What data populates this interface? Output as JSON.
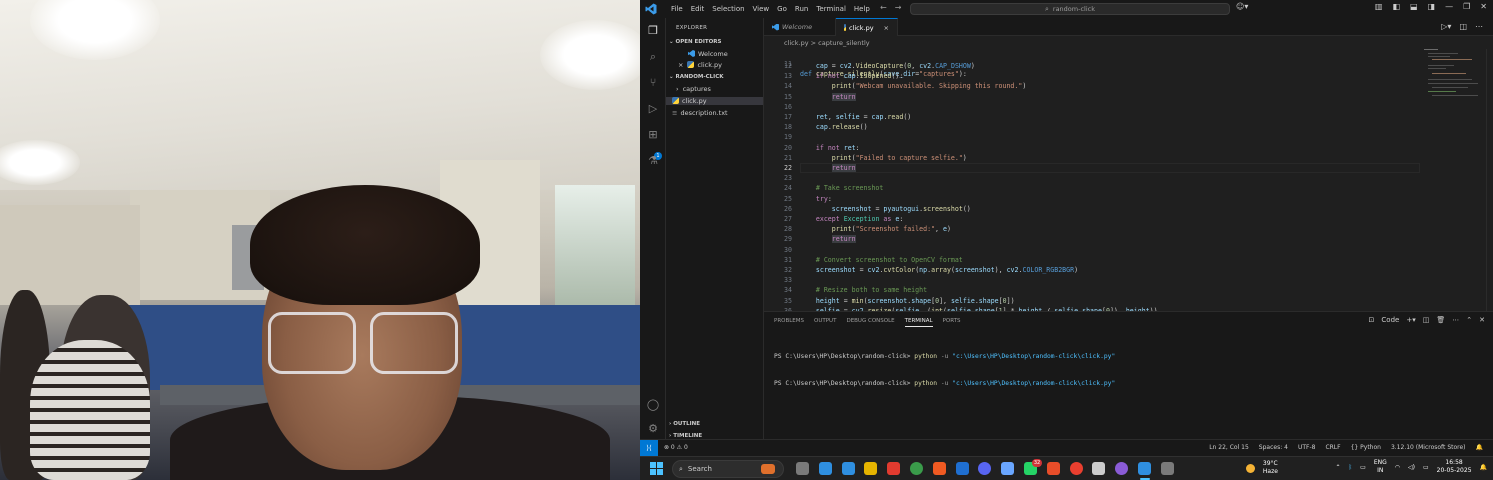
{
  "window": {
    "menu": [
      "File",
      "Edit",
      "Selection",
      "View",
      "Go",
      "Run",
      "Terminal",
      "Help"
    ],
    "command_center": "random-click"
  },
  "sidebar": {
    "title": "EXPLORER",
    "open_editors_label": "OPEN EDITORS",
    "open_editors": [
      {
        "label": "Welcome",
        "icon": "vscode-icon"
      },
      {
        "label": "click.py",
        "icon": "python-file-icon",
        "close": "×"
      }
    ],
    "folder_label": "RANDOM-CLICK",
    "tree": [
      {
        "label": "captures",
        "type": "folder",
        "chevron": "›"
      },
      {
        "label": "click.py",
        "type": "file"
      },
      {
        "label": "description.txt",
        "type": "file"
      }
    ],
    "outline_label": "OUTLINE",
    "timeline_label": "TIMELINE"
  },
  "tabs": [
    {
      "label": "Welcome",
      "active": false
    },
    {
      "label": "click.py",
      "active": true,
      "close": "×"
    }
  ],
  "breadcrumb": {
    "file": "click.py",
    "sep": ">",
    "symbol": "capture_silently"
  },
  "code": {
    "header": "def capture_silently(save_dir=\"captures\"):",
    "current_line": 22,
    "lines": [
      {
        "n": 12,
        "text": "    cap = cv2.VideoCapture(0, cv2.CAP_DSHOW)"
      },
      {
        "n": 13,
        "text": "    if not cap.isOpened():"
      },
      {
        "n": 14,
        "text": "        print(\"Webcam unavailable. Skipping this round.\")"
      },
      {
        "n": 15,
        "text": "        return"
      },
      {
        "n": 16,
        "text": ""
      },
      {
        "n": 17,
        "text": "    ret, selfie = cap.read()"
      },
      {
        "n": 18,
        "text": "    cap.release()"
      },
      {
        "n": 19,
        "text": ""
      },
      {
        "n": 20,
        "text": "    if not ret:"
      },
      {
        "n": 21,
        "text": "        print(\"Failed to capture selfie.\")"
      },
      {
        "n": 22,
        "text": "        return"
      },
      {
        "n": 23,
        "text": ""
      },
      {
        "n": 24,
        "text": "    # Take screenshot"
      },
      {
        "n": 25,
        "text": "    try:"
      },
      {
        "n": 26,
        "text": "        screenshot = pyautogui.screenshot()"
      },
      {
        "n": 27,
        "text": "    except Exception as e:"
      },
      {
        "n": 28,
        "text": "        print(\"Screenshot failed:\", e)"
      },
      {
        "n": 29,
        "text": "        return"
      },
      {
        "n": 30,
        "text": ""
      },
      {
        "n": 31,
        "text": "    # Convert screenshot to OpenCV format"
      },
      {
        "n": 32,
        "text": "    screenshot = cv2.cvtColor(np.array(screenshot), cv2.COLOR_RGB2BGR)"
      },
      {
        "n": 33,
        "text": ""
      },
      {
        "n": 34,
        "text": "    # Resize both to same height"
      },
      {
        "n": 35,
        "text": "    height = min(screenshot.shape[0], selfie.shape[0])"
      },
      {
        "n": 36,
        "text": "    selfie = cv2.resize(selfie, (int(selfie.shape[1] * height / selfie.shape[0]), height))"
      }
    ]
  },
  "panel": {
    "tabs": [
      "PROBLEMS",
      "OUTPUT",
      "DEBUG CONSOLE",
      "TERMINAL",
      "PORTS"
    ],
    "active_tab": "TERMINAL",
    "terminal_kind": "Code",
    "terminal_lines": [
      {
        "prompt": "PS C:\\Users\\HP\\Desktop\\random-click>",
        "cmd": "python",
        "flag": "-u",
        "path": "\"c:\\Users\\HP\\Desktop\\random-click\\click.py\""
      },
      {
        "prompt": "PS C:\\Users\\HP\\Desktop\\random-click>",
        "cmd": "python",
        "flag": "-u",
        "path": "\"c:\\Users\\HP\\Desktop\\random-click\\click.py\""
      }
    ]
  },
  "statusbar": {
    "problems": "⊗ 0 ⚠ 0",
    "position": "Ln 22, Col 15",
    "spaces": "Spaces: 4",
    "encoding": "UTF-8",
    "eol": "CRLF",
    "language": "{} Python",
    "interpreter": "3.12.10 (Microsoft Store)"
  },
  "taskbar": {
    "search_placeholder": "Search",
    "weather_temp": "39°C",
    "weather_desc": "Haze",
    "lang_line1": "ENG",
    "lang_line2": "IN",
    "time": "16:58",
    "date": "20-05-2025",
    "app_colors": [
      "#7a7a7a",
      "#2f8fe0",
      "#2f8fe0",
      "#e6b400",
      "#e23b2f",
      "#3a9b4a",
      "#f05a22",
      "#1f6fd1",
      "#5865f2",
      "#6aa6ff",
      "#25d366",
      "#e84d29",
      "#ea3f2f",
      "#cccccc",
      "#8a5bd6",
      "#2f8fe0",
      "#7a7a7a"
    ],
    "whatsapp_badge": "32"
  }
}
